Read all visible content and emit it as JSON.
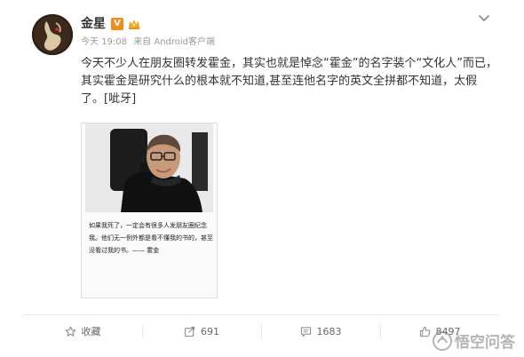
{
  "author": {
    "name": "金星",
    "verified_badge": "V"
  },
  "meta": {
    "time": "今天 19:08",
    "source": "来自 Android客户端"
  },
  "post": {
    "text": "今天不少人在朋友圈转发霍金，其实也就是悼念“霍金”的名字装个“文化人”而已，其实霍金是研究什么的根本就不知道,甚至连他名字的英文全拼都不知道，太假了。[呲牙]"
  },
  "image_card": {
    "caption": "如果我死了，一定会有很多人发朋友圈纪念我。他们无一例外都是看不懂我的书的，甚至没看过我的书。—— 霍金"
  },
  "actions": {
    "collect": {
      "label": "收藏",
      "icon": "star-icon"
    },
    "forward": {
      "count": "691",
      "icon": "share-icon"
    },
    "comment": {
      "count": "1683",
      "icon": "comment-icon"
    },
    "like": {
      "count": "8497",
      "icon": "thumbs-up-icon"
    }
  },
  "watermark": {
    "text": "悟空问答"
  },
  "colors": {
    "badge_orange": "#f08c19",
    "meta_gray": "#9a9a9a",
    "text": "#333333"
  }
}
